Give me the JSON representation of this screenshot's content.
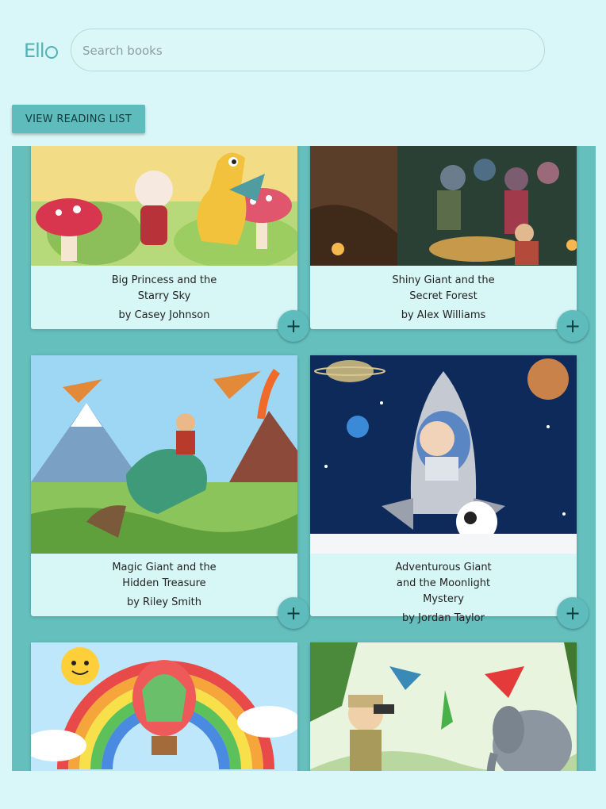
{
  "header": {
    "logo_text": "Ell",
    "search_placeholder": "Search books"
  },
  "actions": {
    "reading_list_label": "VIEW READING LIST"
  },
  "books": [
    {
      "title_line1": "Big Princess and the",
      "title_line2": "Starry Sky",
      "title_line3": "",
      "author": "by Casey Johnson",
      "add_label": "+"
    },
    {
      "title_line1": "Shiny Giant and the",
      "title_line2": "Secret Forest",
      "title_line3": "",
      "author": "by Alex Williams",
      "add_label": "+"
    },
    {
      "title_line1": "Magic Giant and the",
      "title_line2": "Hidden Treasure",
      "title_line3": "",
      "author": "by Riley Smith",
      "add_label": "+"
    },
    {
      "title_line1": "Adventurous Giant",
      "title_line2": "and the Moonlight",
      "title_line3": "Mystery",
      "author": "by Jordan Taylor",
      "add_label": "+"
    }
  ],
  "colors": {
    "background": "#d9f7f8",
    "accent": "#5fbcbc",
    "panel": "#64bfbd"
  },
  "icons": {
    "add": "plus-icon",
    "logo": "ello-logo"
  }
}
